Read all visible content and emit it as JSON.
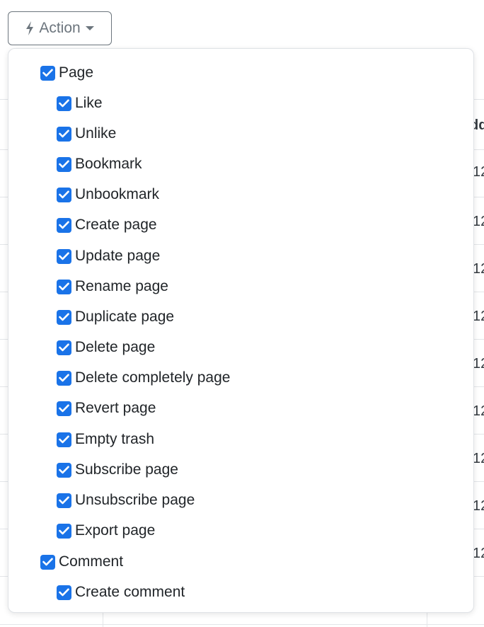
{
  "colors": {
    "checkbox": "#1a73e8",
    "button_text": "#6c757d",
    "border": "#dfe2e6"
  },
  "action_button": {
    "label": "Action",
    "icon": "lightning-icon",
    "caret_icon": "caret-down-icon"
  },
  "background_table": {
    "header_fragment": "dd",
    "cell_fragments": [
      "12",
      "12",
      "12",
      "12",
      "12",
      "12",
      "12",
      "12",
      "12"
    ]
  },
  "dropdown": {
    "groups": [
      {
        "label": "Page",
        "checked": true,
        "items": [
          {
            "label": "Like",
            "checked": true
          },
          {
            "label": "Unlike",
            "checked": true
          },
          {
            "label": "Bookmark",
            "checked": true
          },
          {
            "label": "Unbookmark",
            "checked": true
          },
          {
            "label": "Create page",
            "checked": true
          },
          {
            "label": "Update page",
            "checked": true
          },
          {
            "label": "Rename page",
            "checked": true
          },
          {
            "label": "Duplicate page",
            "checked": true
          },
          {
            "label": "Delete page",
            "checked": true
          },
          {
            "label": "Delete completely page",
            "checked": true
          },
          {
            "label": "Revert page",
            "checked": true
          },
          {
            "label": "Empty trash",
            "checked": true
          },
          {
            "label": "Subscribe page",
            "checked": true
          },
          {
            "label": "Unsubscribe page",
            "checked": true
          },
          {
            "label": "Export page",
            "checked": true
          }
        ]
      },
      {
        "label": "Comment",
        "checked": true,
        "items": [
          {
            "label": "Create comment",
            "checked": true
          }
        ]
      }
    ]
  }
}
